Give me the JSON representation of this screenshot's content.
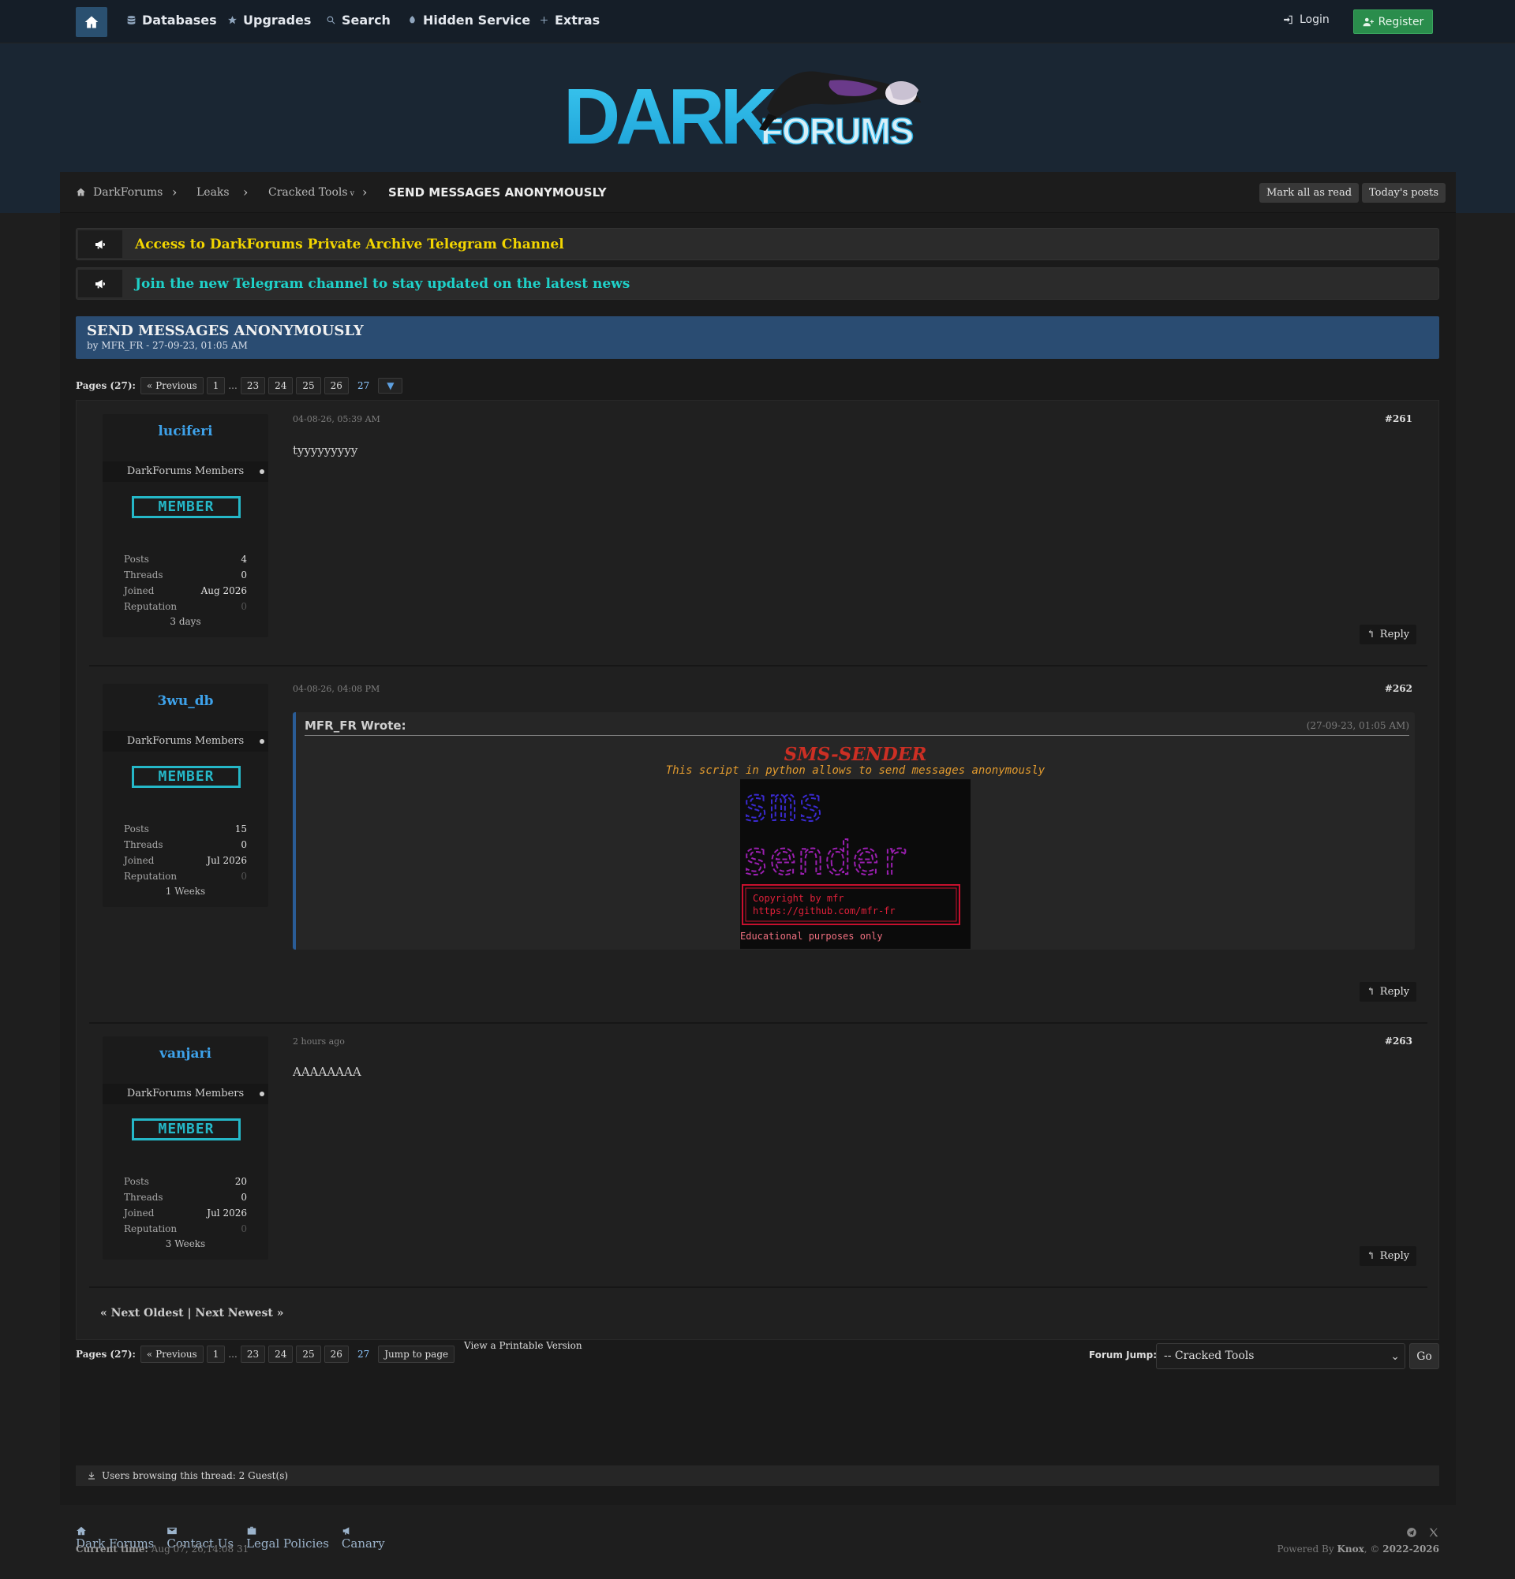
{
  "nav": {
    "items": [
      {
        "label": "Databases",
        "icon": "database-icon"
      },
      {
        "label": "Upgrades",
        "icon": "star-icon"
      },
      {
        "label": "Search",
        "icon": "search-icon"
      },
      {
        "label": "Hidden Service",
        "icon": "onion-icon"
      },
      {
        "label": "Extras",
        "icon": "plus-icon"
      }
    ],
    "login": "Login",
    "register": "Register"
  },
  "logo": {
    "dark": "DARK",
    "forums": "FORUMS"
  },
  "breadcrumb": {
    "items": [
      "DarkForums",
      "Leaks",
      "Cracked Tools"
    ],
    "current": "SEND MESSAGES ANONYMOUSLY",
    "mark_read": "Mark all as read",
    "todays_posts": "Today's posts"
  },
  "announcements": [
    {
      "text": "Access to DarkForums Private Archive Telegram Channel",
      "color": "#f2d500"
    },
    {
      "text": "Join the new Telegram channel to stay updated on the latest news",
      "color": "#1fd1c9"
    }
  ],
  "thread": {
    "title": "SEND MESSAGES ANONYMOUSLY",
    "byline": "by MFR_FR - 27-09-23, 01:05 AM"
  },
  "pagination": {
    "label": "Pages (27):",
    "previous": "« Previous",
    "pages": [
      "1",
      "...",
      "23",
      "24",
      "25",
      "26"
    ],
    "current": "27",
    "jump": "Jump to page"
  },
  "posts": [
    {
      "username": "luciferi",
      "group": "DarkForums Members",
      "badge": "MEMBER",
      "stats": [
        {
          "k": "Posts",
          "v": "4"
        },
        {
          "k": "Threads",
          "v": "0"
        },
        {
          "k": "Joined",
          "v": "Aug 2026"
        },
        {
          "k": "Reputation",
          "v": "0"
        }
      ],
      "ago": "3 days",
      "date": "04-08-26, 05:39 AM",
      "number": "#261",
      "body": "tyyyyyyyyy",
      "reply": "Reply"
    },
    {
      "username": "3wu_db",
      "group": "DarkForums Members",
      "badge": "MEMBER",
      "stats": [
        {
          "k": "Posts",
          "v": "15"
        },
        {
          "k": "Threads",
          "v": "0"
        },
        {
          "k": "Joined",
          "v": "Jul 2026"
        },
        {
          "k": "Reputation",
          "v": "0"
        }
      ],
      "ago": "1 Weeks",
      "date": "04-08-26, 04:08 PM",
      "number": "#262",
      "body": "",
      "reply": "Reply",
      "quote": {
        "author": "MFR_FR Wrote:",
        "date": "(27-09-23, 01:05 AM)",
        "title": "SMS-SENDER",
        "description": "This script in python allows to send messages anonymously",
        "banner_words": [
          "sms",
          "sender"
        ],
        "copyright": "Copyright by mfr",
        "url": "https://github.com/mfr-fr",
        "footer": "Educational purposes only"
      }
    },
    {
      "username": "vanjari",
      "group": "DarkForums Members",
      "badge": "MEMBER",
      "stats": [
        {
          "k": "Posts",
          "v": "20"
        },
        {
          "k": "Threads",
          "v": "0"
        },
        {
          "k": "Joined",
          "v": "Jul 2026"
        },
        {
          "k": "Reputation",
          "v": "0"
        }
      ],
      "ago": "3 Weeks",
      "date": "2 hours ago",
      "number": "#263",
      "body": "AAAAAAAA",
      "reply": "Reply"
    }
  ],
  "next_links": "« Next Oldest | Next Newest »",
  "printable": "View a Printable Version",
  "forum_jump": {
    "label": "Forum Jump:",
    "selected": "-- Cracked Tools",
    "go": "Go"
  },
  "browsing": "Users browsing this thread: 2 Guest(s)",
  "footer": {
    "links": [
      "Dark Forums",
      "Contact Us",
      "Legal Policies",
      "Canary"
    ],
    "current_time_label": "Current time:",
    "current_time": "Aug 07, 26,14:08 31",
    "powered_prefix": "Powered By",
    "powered_name": "Knox",
    "powered_suffix": ", ©",
    "years": "2022-2026"
  }
}
